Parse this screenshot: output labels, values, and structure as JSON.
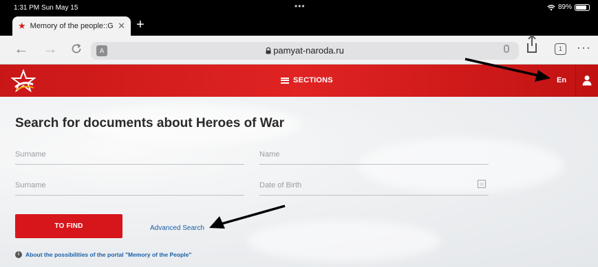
{
  "status_bar": {
    "time": "1:31 PM  Sun May 15",
    "battery": "89%"
  },
  "browser": {
    "tab_title": "Memory of the people::G",
    "url": "pamyat-naroda.ru",
    "tab_count": "1"
  },
  "site": {
    "menu_label": "SECTIONS",
    "language": "En",
    "heading": "Search for documents about Heroes of War",
    "fields": {
      "surname_1": "Surname",
      "name": "Name",
      "surname_2": "Surname",
      "date_of_birth": "Date of Birth"
    },
    "find_button": "TO FIND",
    "advanced_search": "Advanced Search",
    "about_link": "About the possibilities of the portal \"Memory of the People\""
  },
  "colors": {
    "brand_red": "#d7161c",
    "link_blue": "#1b5fa6"
  }
}
